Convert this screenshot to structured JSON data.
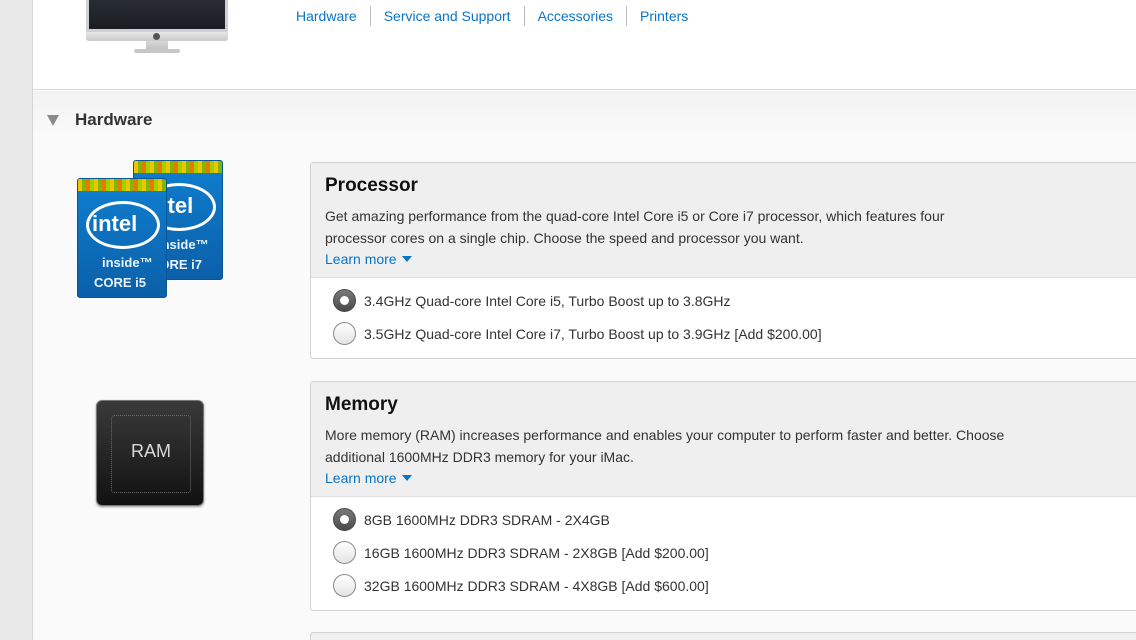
{
  "nav": {
    "items": [
      "Hardware",
      "Service and Support",
      "Accessories",
      "Printers"
    ]
  },
  "hardware": {
    "title": "Hardware"
  },
  "processor": {
    "title": "Processor",
    "description": "Get amazing performance from the quad-core Intel Core i5 or Core i7 processor, which features four processor cores on a single chip. Choose the speed and processor you want.",
    "learn_more": "Learn more",
    "options": [
      {
        "label": "3.4GHz Quad-core Intel Core i5, Turbo Boost up to 3.8GHz",
        "selected": true
      },
      {
        "label": "3.5GHz Quad-core Intel Core i7, Turbo Boost up to 3.9GHz [Add $200.00]",
        "selected": false
      }
    ],
    "badge": {
      "brand": "intel",
      "inside": "inside™",
      "core_front": "CORE i5",
      "core_back": "CORE i7"
    }
  },
  "memory": {
    "title": "Memory",
    "description": "More memory (RAM) increases performance and enables your computer to perform faster and better. Choose additional 1600MHz DDR3 memory for your iMac.",
    "learn_more": "Learn more",
    "options": [
      {
        "label": "8GB 1600MHz DDR3 SDRAM - 2X4GB",
        "selected": true
      },
      {
        "label": "16GB 1600MHz DDR3 SDRAM - 2X8GB [Add $200.00]",
        "selected": false
      },
      {
        "label": "32GB 1600MHz DDR3 SDRAM - 4X8GB [Add $600.00]",
        "selected": false
      }
    ],
    "chip_label": "RAM"
  },
  "colors": {
    "link": "#0a74c6",
    "panel_header": "#efefef"
  }
}
